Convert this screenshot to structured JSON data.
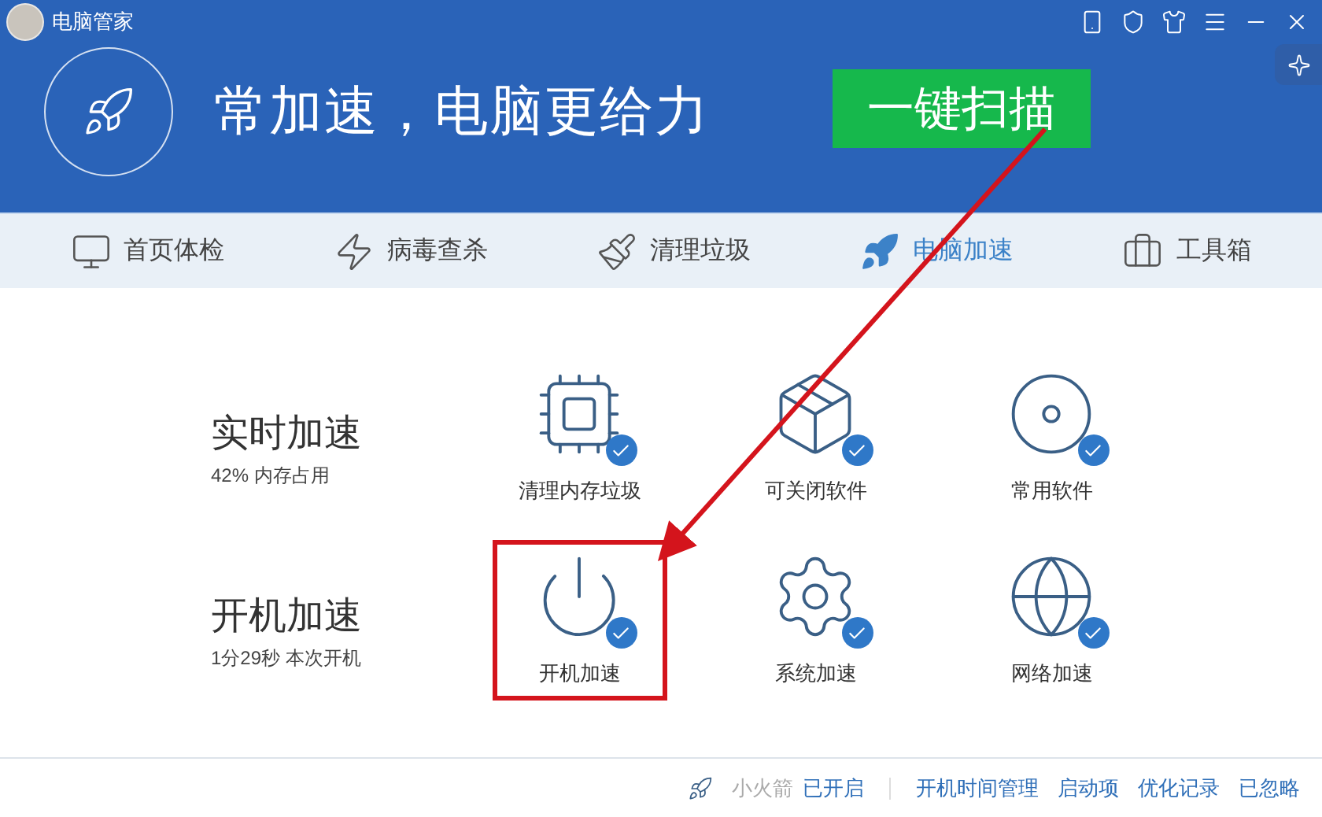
{
  "window": {
    "title": "电脑管家"
  },
  "header": {
    "slogan": "常加速，电脑更给力",
    "scan_button": "一键扫描"
  },
  "tabs": [
    {
      "label": "首页体检",
      "kind": "monitor",
      "selected": false
    },
    {
      "label": "病毒查杀",
      "kind": "bolt",
      "selected": false
    },
    {
      "label": "清理垃圾",
      "kind": "broom",
      "selected": false
    },
    {
      "label": "电脑加速",
      "kind": "rocket",
      "selected": true
    },
    {
      "label": "工具箱",
      "kind": "toolbox",
      "selected": false
    }
  ],
  "sections": [
    {
      "title": "实时加速",
      "subtitle": "42% 内存占用",
      "items": [
        {
          "label": "清理内存垃圾",
          "kind": "memory",
          "checked": true,
          "highlighted": false
        },
        {
          "label": "可关闭软件",
          "kind": "software",
          "checked": true,
          "highlighted": false
        },
        {
          "label": "常用软件",
          "kind": "disc",
          "checked": true,
          "highlighted": false
        }
      ]
    },
    {
      "title": "开机加速",
      "subtitle": "1分29秒 本次开机",
      "items": [
        {
          "label": "开机加速",
          "kind": "power",
          "checked": true,
          "highlighted": true
        },
        {
          "label": "系统加速",
          "kind": "gear",
          "checked": true,
          "highlighted": false
        },
        {
          "label": "网络加速",
          "kind": "network",
          "checked": true,
          "highlighted": false
        }
      ]
    }
  ],
  "footer": {
    "rocket_label": "小火箭",
    "rocket_status": "已开启",
    "links": [
      "开机时间管理",
      "启动项",
      "优化记录",
      "已忽略"
    ]
  }
}
